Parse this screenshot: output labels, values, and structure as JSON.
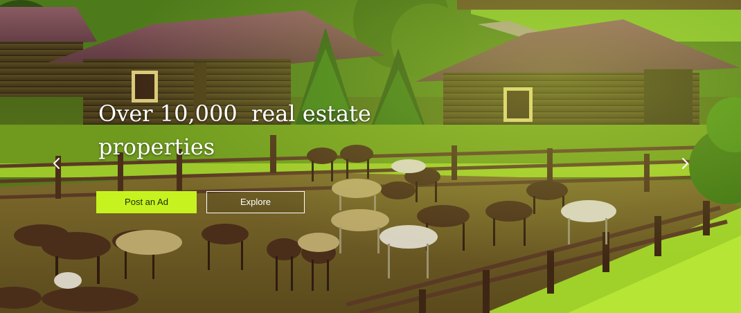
{
  "hero": {
    "title": "Over 10,000  real estate properties",
    "primary_button_label": "Post an Ad",
    "secondary_button_label": "Explore",
    "accent_color": "#c6f31f"
  },
  "carousel": {
    "prev_icon": "chevron-left-icon",
    "next_icon": "chevron-right-icon"
  }
}
